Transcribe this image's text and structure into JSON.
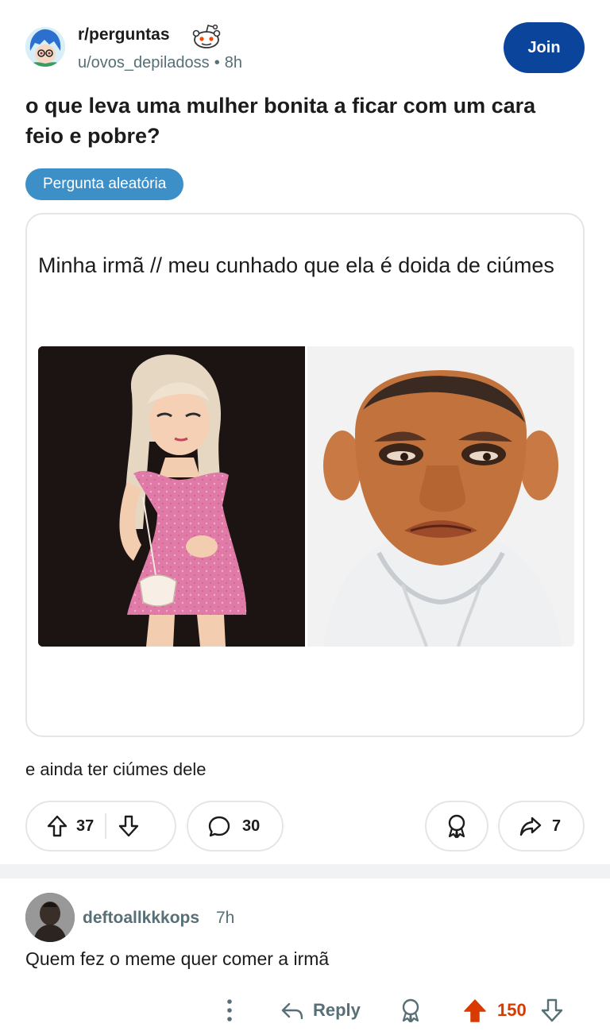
{
  "post": {
    "subreddit": "r/perguntas",
    "author": "u/ovos_depiladoss",
    "separator": "•",
    "age": "8h",
    "join_label": "Join",
    "title": "o que leva uma mulher bonita a ficar com um cara feio e pobre?",
    "flair": "Pergunta aleatória",
    "image_caption": "Minha irmã // meu cunhado que ela é doida de ciúmes",
    "body": "e ainda ter ciúmes dele",
    "upvotes": "37",
    "comments": "30",
    "shares": "7"
  },
  "comment": {
    "author": "deftoallkkkops",
    "age": "7h",
    "text": "Quem fez o meme quer comer a irmã",
    "reply_label": "Reply",
    "score": "150"
  },
  "icons": {
    "upvote": "arrow-up-icon",
    "downvote": "arrow-down-icon",
    "comment": "speech-bubble-icon",
    "award": "award-icon",
    "share": "share-arrow-icon",
    "more": "vertical-dots-icon",
    "reply": "reply-arrow-icon"
  },
  "colors": {
    "join_button": "#0a449b",
    "flair": "#3d8fc8",
    "upvoted": "#d93a00",
    "meta_text": "#576f76"
  }
}
